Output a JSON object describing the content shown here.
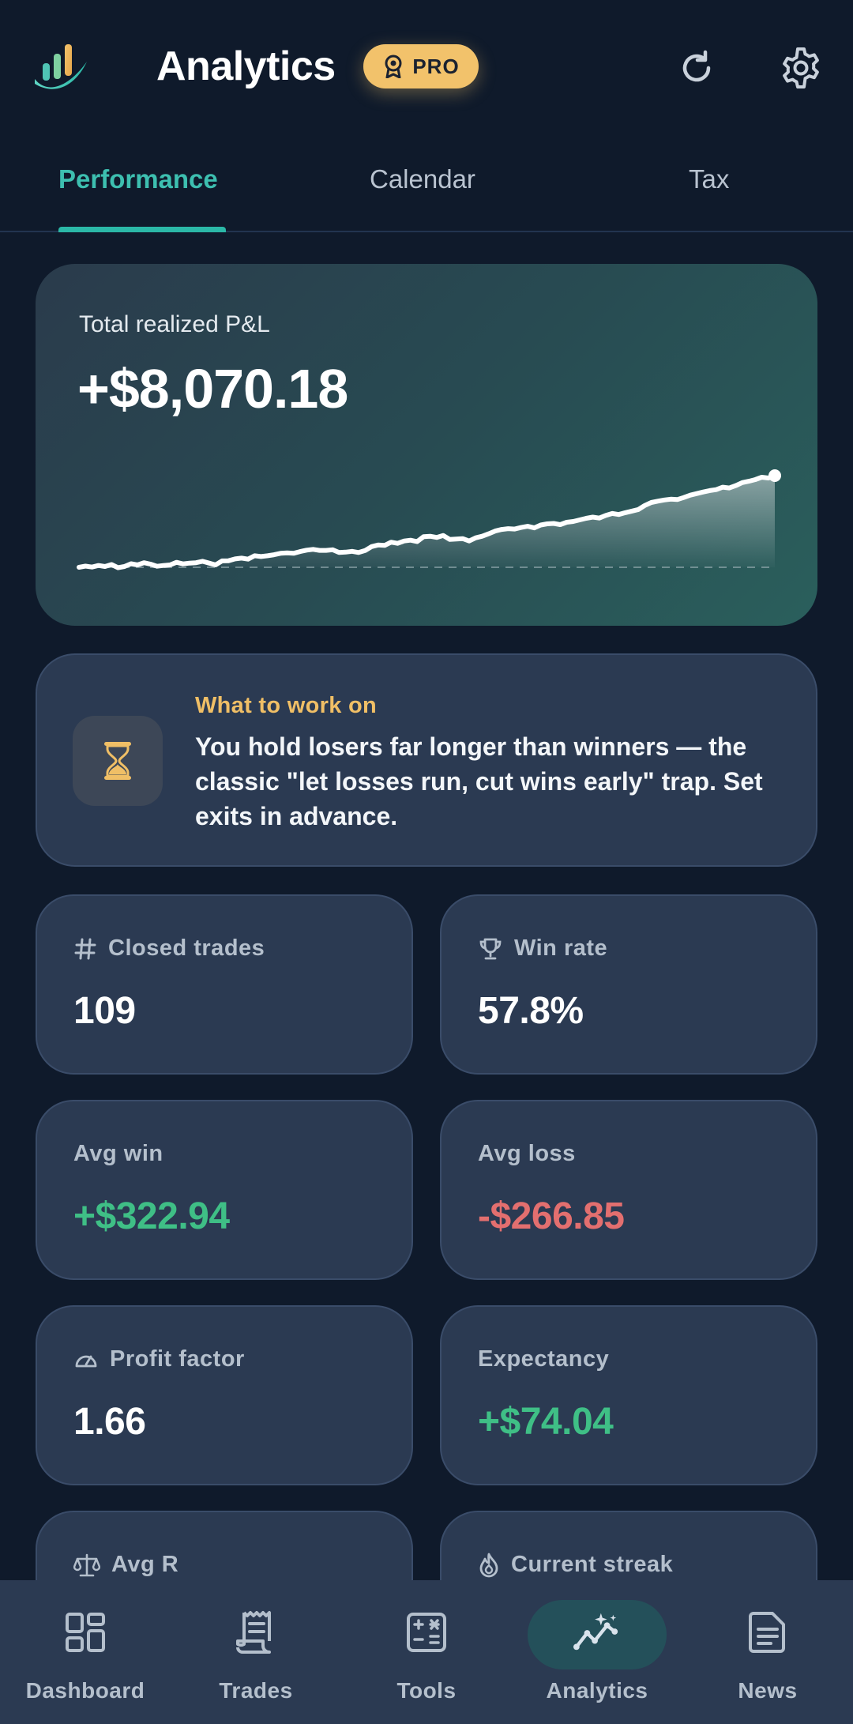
{
  "header": {
    "title": "Analytics",
    "badge": "PRO"
  },
  "tabs": [
    {
      "label": "Performance",
      "active": true
    },
    {
      "label": "Calendar",
      "active": false
    },
    {
      "label": "Tax",
      "active": false
    }
  ],
  "pnl": {
    "label": "Total realized P&L",
    "value": "+$8,070.18"
  },
  "chart_data": {
    "type": "area",
    "title": "",
    "series": [
      {
        "values": [
          0,
          60,
          10,
          90,
          40,
          140,
          -20,
          40,
          180,
          120,
          230,
          160,
          50,
          90,
          120,
          250,
          170,
          210,
          230,
          300,
          210,
          120,
          320,
          330,
          420,
          460,
          410,
          580,
          540,
          580,
          630,
          700,
          720,
          700,
          790,
          860,
          900,
          850,
          850,
          880,
          740,
          760,
          800,
          740,
          840,
          1040,
          1120,
          1100,
          1260,
          1200,
          1320,
          1360,
          1290,
          1540,
          1560,
          1500,
          1600,
          1400,
          1420,
          1440,
          1320,
          1480,
          1560,
          1680,
          1820,
          1900,
          1940,
          1920,
          2000,
          2060,
          1980,
          2120,
          2180,
          2200,
          2140,
          2260,
          2300,
          2380,
          2460,
          2520,
          2470,
          2600,
          2700,
          2650,
          2740,
          2820,
          2900,
          3100,
          3250,
          3320,
          3380,
          3420,
          3400,
          3500,
          3620,
          3700,
          3780,
          3850,
          3900,
          4020,
          3980,
          4100,
          4250,
          4320,
          4400,
          4520,
          4480,
          4600
        ]
      }
    ],
    "baseline": 0,
    "grid": false,
    "legend": "none"
  },
  "insight": {
    "title": "What to work on",
    "text": "You hold losers far longer than winners — the classic \"let losses run, cut wins early\" trap. Set exits in advance.",
    "icon": "hourglass-icon"
  },
  "stats": {
    "closed_trades": {
      "label": "Closed trades",
      "value": "109"
    },
    "win_rate": {
      "label": "Win rate",
      "value": "57.8%"
    },
    "avg_win": {
      "label": "Avg win",
      "value": "+$322.94"
    },
    "avg_loss": {
      "label": "Avg loss",
      "value": "-$266.85"
    },
    "profit_factor": {
      "label": "Profit factor",
      "value": "1.66"
    },
    "expectancy": {
      "label": "Expectancy",
      "value": "+$74.04"
    },
    "avg_r": {
      "label": "Avg R",
      "value": ""
    },
    "current_streak": {
      "label": "Current streak",
      "value": ""
    }
  },
  "colors": {
    "accent": "#2bb8a7",
    "positive": "#3fbf86",
    "negative": "#e36f6f",
    "pro_badge": "#f2c26b",
    "insight_title": "#f0bf66"
  },
  "nav": [
    {
      "label": "Dashboard",
      "icon": "dashboard-icon"
    },
    {
      "label": "Trades",
      "icon": "receipt-icon"
    },
    {
      "label": "Tools",
      "icon": "calculator-icon"
    },
    {
      "label": "Analytics",
      "icon": "analytics-icon",
      "active": true
    },
    {
      "label": "News",
      "icon": "news-icon"
    }
  ]
}
